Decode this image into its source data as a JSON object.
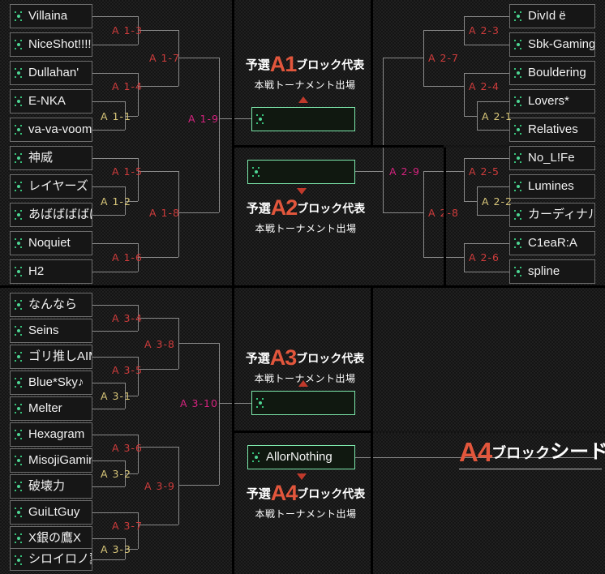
{
  "meta": {
    "accent_red": "#e2563c",
    "match_red": "#cf3c3c",
    "match_tan": "#d9c77a",
    "match_magenta": "#d6237f",
    "winner_border_green": "#7de8ac",
    "marker_icon": "team-marker-icon"
  },
  "blocks": {
    "a1": {
      "prefix": "予選",
      "code": "A1",
      "suffix": "ブロック代表",
      "sub": "本戦トーナメント出場"
    },
    "a2": {
      "prefix": "予選",
      "code": "A2",
      "suffix": "ブロック代表",
      "sub": "本戦トーナメント出場"
    },
    "a3": {
      "prefix": "予選",
      "code": "A3",
      "suffix": "ブロック代表",
      "sub": "本戦トーナメント出場"
    },
    "a4": {
      "prefix": "予選",
      "code": "A4",
      "suffix": "ブロック代表",
      "sub": "本戦トーナメント出場"
    }
  },
  "seed": {
    "code": "A4",
    "kana1": "ブロック",
    "kana2": "シード"
  },
  "teams": {
    "a1": [
      "Villaina",
      "NiceShot!!!!",
      "Dullahan'",
      "E-NKA",
      "va-va-voom\"",
      "神威",
      "レイヤーズ",
      "あばばばばば",
      "Noquiet",
      "H2"
    ],
    "a2": [
      "DivId ë",
      "Sbk-Gaming",
      "Bouldering",
      "Lovers*",
      "Relatives",
      "No_L!Fe",
      "Lumines",
      "カーディナルス",
      "C1eaR:A",
      "spline"
    ],
    "a3": [
      "なんなら",
      "Seins",
      "ゴリ推しAIM",
      "Blue*Sky♪",
      "Melter",
      "Hexagram",
      "MisojiGaming",
      "破壊力",
      "GuiLtGuy",
      "X銀の鷹X",
      "シロイロノ翼"
    ]
  },
  "winners": {
    "a1": "",
    "a2": "",
    "a3": "",
    "a4": "AllorNothing"
  },
  "matches": {
    "a1": {
      "m1": "A 1-1",
      "m2": "A 1-2",
      "m3": "A 1-3",
      "m4": "A 1-4",
      "m5": "A 1-5",
      "m6": "A 1-6",
      "m7": "A 1-7",
      "m8": "A 1-8",
      "m9": "A 1-9"
    },
    "a2": {
      "m1": "A 2-1",
      "m2": "A 2-2",
      "m3": "A 2-3",
      "m4": "A 2-4",
      "m5": "A 2-5",
      "m6": "A 2-6",
      "m7": "A 2-7",
      "m8": "A 2-8",
      "m9": "A 2-9"
    },
    "a3": {
      "m1": "A 3-1",
      "m2": "A 3-2",
      "m3": "A 3-3",
      "m4": "A 3-4",
      "m5": "A 3-5",
      "m6": "A 3-6",
      "m7": "A 3-7",
      "m8": "A 3-8",
      "m9": "A 3-9",
      "m10": "A 3-10"
    }
  }
}
